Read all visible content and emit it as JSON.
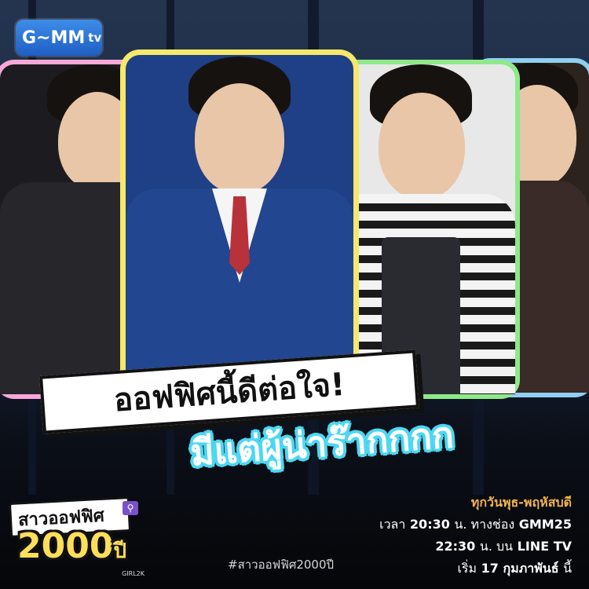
{
  "brand": {
    "logo_text": "G~MM",
    "logo_tv": "tv"
  },
  "headline": {
    "line1": "ออฟฟิศนี้ดีต่อใจ!",
    "line2": "มีแต่ผู้น่าร๊ากกกก"
  },
  "show": {
    "title": "สาวออฟฟิศ",
    "year": "2000",
    "year_suffix": "ปี",
    "sub": "GIRL2K",
    "hashtag": "#สาวออฟฟิศ2000ปี"
  },
  "schedule": {
    "days": "ทุกวันพุธ-พฤหัสบดี",
    "line2_prefix": "เวลา",
    "line2_time": "20:30",
    "line2_mid": "น. ทางช่อง",
    "line2_channel": "GMM25",
    "line3_time": "22:30",
    "line3_mid": "น. บน",
    "line3_channel": "LINE TV",
    "line4_prefix": "เริ่ม",
    "line4_date": "17 กุมภาพันธ์",
    "line4_suffix": "นี้"
  },
  "colors": {
    "outline_pink": "#f7a8d8",
    "outline_yellow": "#f6e86a",
    "outline_green": "#8fe88a",
    "outline_blue": "#8ecff2",
    "headline_cyan": "#4dd7f2",
    "accent_orange": "#f2b24d",
    "logo_blue": "#2f7ad8"
  }
}
